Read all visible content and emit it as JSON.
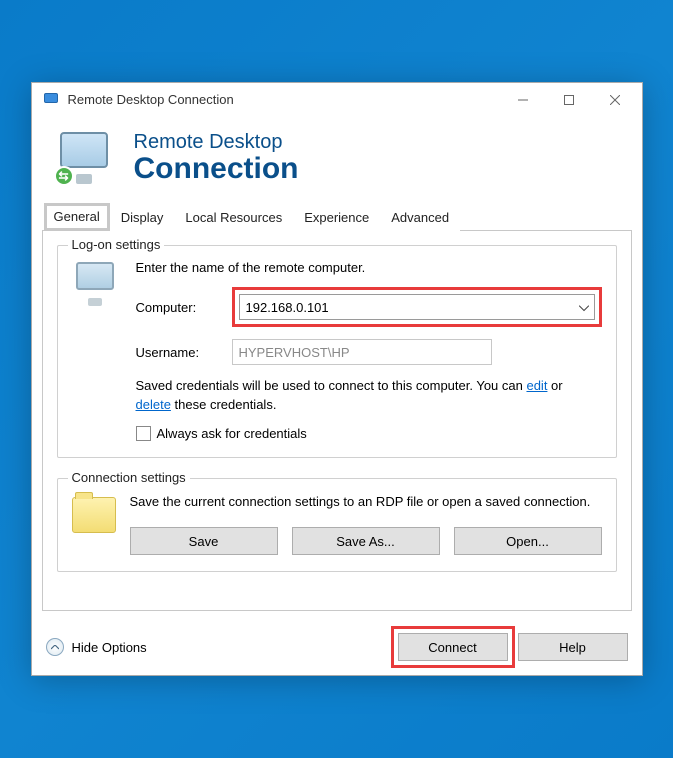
{
  "titlebar": {
    "title": "Remote Desktop Connection"
  },
  "header": {
    "line1": "Remote Desktop",
    "line2": "Connection"
  },
  "tabs": {
    "general": "General",
    "display": "Display",
    "local_resources": "Local Resources",
    "experience": "Experience",
    "advanced": "Advanced"
  },
  "logon": {
    "legend": "Log-on settings",
    "instruction": "Enter the name of the remote computer.",
    "computer_label": "Computer:",
    "computer_value": "192.168.0.101",
    "username_label": "Username:",
    "username_value": "HYPERVHOST\\HP",
    "saved_pre": "Saved credentials will be used to connect to this computer. You can ",
    "edit_link": "edit",
    "mid": " or ",
    "delete_link": "delete",
    "saved_post": " these credentials.",
    "always_ask": "Always ask for credentials"
  },
  "conn": {
    "legend": "Connection settings",
    "text": "Save the current connection settings to an RDP file or open a saved connection.",
    "save": "Save",
    "save_as": "Save As...",
    "open": "Open..."
  },
  "footer": {
    "hide": "Hide Options",
    "connect": "Connect",
    "help": "Help"
  }
}
